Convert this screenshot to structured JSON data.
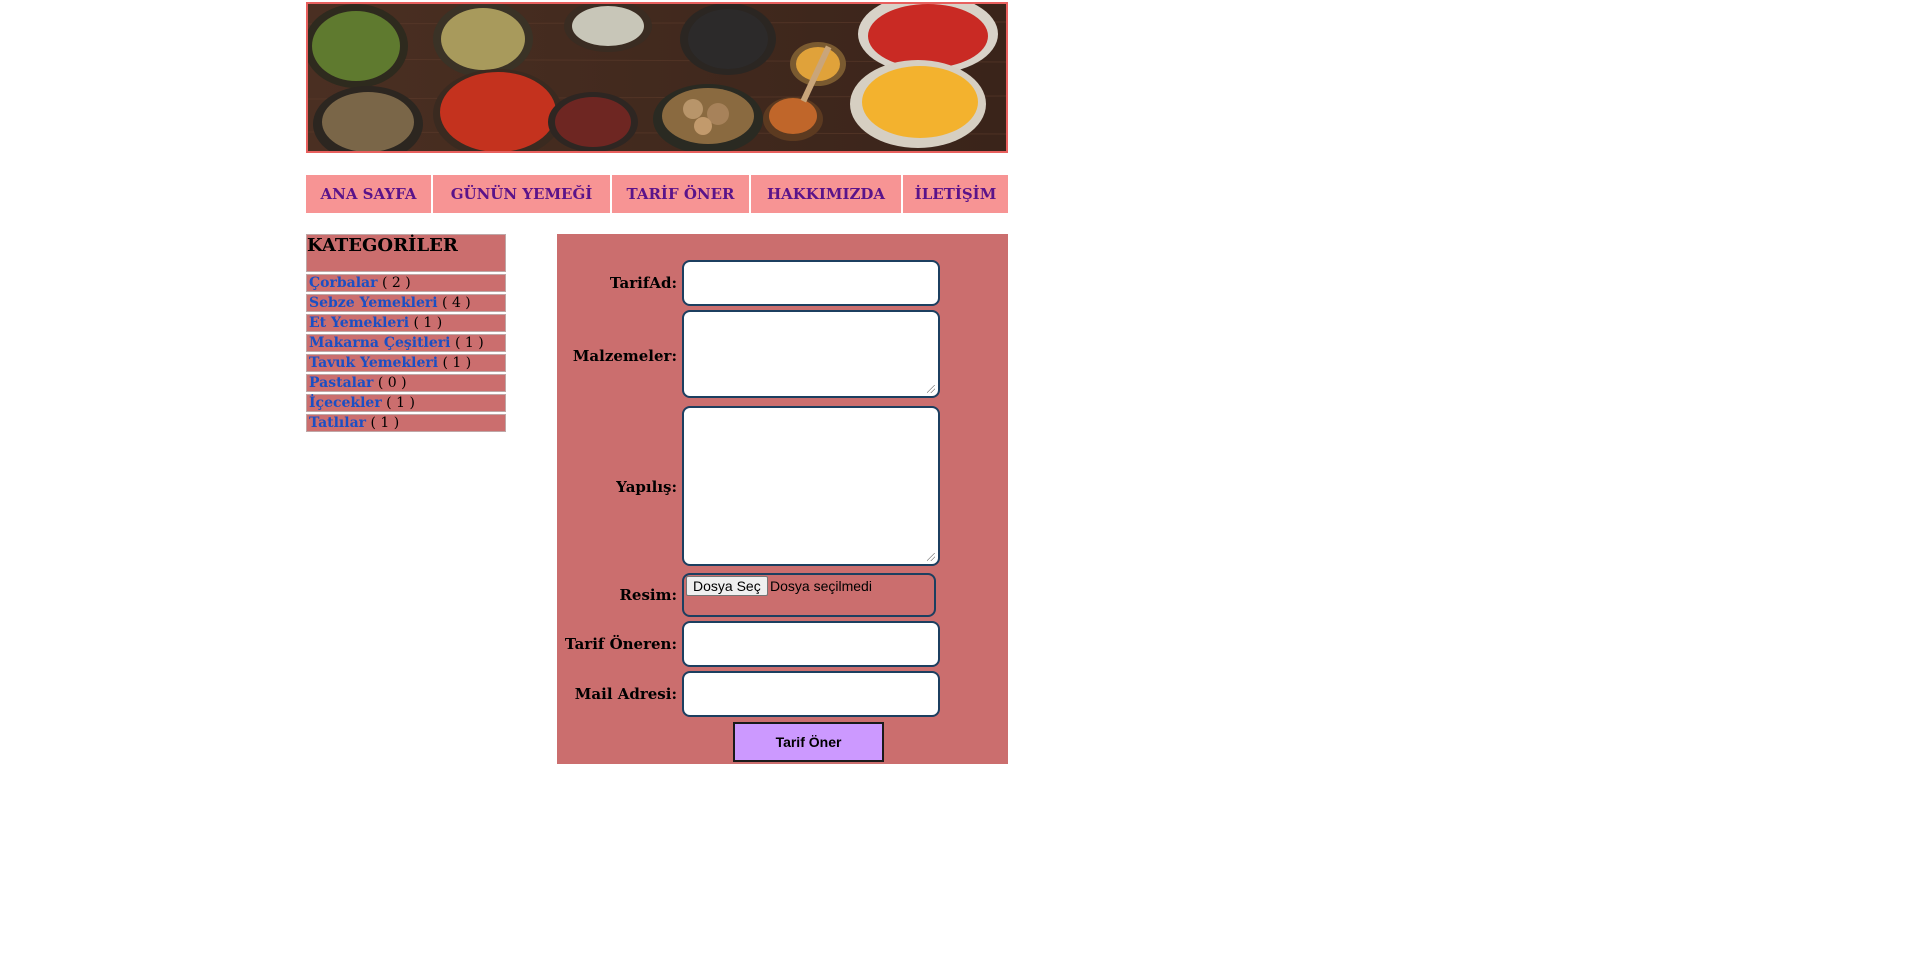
{
  "banner": {
    "image": "spices-banner"
  },
  "nav": {
    "items": [
      {
        "label": "ANA SAYFA"
      },
      {
        "label": "GÜNÜN YEMEĞİ"
      },
      {
        "label": "TARİF ÖNER"
      },
      {
        "label": "HAKKIMIZDA"
      },
      {
        "label": "İLETİŞİM"
      }
    ]
  },
  "sidebar": {
    "title": "KATEGORİLER",
    "categories": [
      {
        "name": "Çorbalar",
        "count": "( 2 )"
      },
      {
        "name": "Sebze Yemekleri",
        "count": "( 4 )"
      },
      {
        "name": "Et Yemekleri",
        "count": "( 1 )"
      },
      {
        "name": "Makarna Çeşitleri",
        "count": "( 1 )"
      },
      {
        "name": "Tavuk Yemekleri",
        "count": "( 1 )"
      },
      {
        "name": "Pastalar",
        "count": "( 0 )"
      },
      {
        "name": "İçecekler",
        "count": "( 1 )"
      },
      {
        "name": "Tatlılar",
        "count": "( 1 )"
      }
    ]
  },
  "form": {
    "recipe_name_label": "TarifAd:",
    "ingredients_label": "Malzemeler:",
    "preparation_label": "Yapılış:",
    "image_label": "Resim:",
    "file_button_label": "Dosya Seç",
    "file_status": "Dosya seçilmedi",
    "submitter_label": "Tarif Öneren:",
    "email_label": "Mail Adresi:",
    "submit_label": "Tarif Öner"
  },
  "colors": {
    "nav_bg": "#f79494",
    "nav_text": "#5a138a",
    "panel_bg": "#cb6e6e",
    "link": "#1a4fc4",
    "submit_bg": "#cc99ff",
    "field_border": "#1c3f60"
  }
}
